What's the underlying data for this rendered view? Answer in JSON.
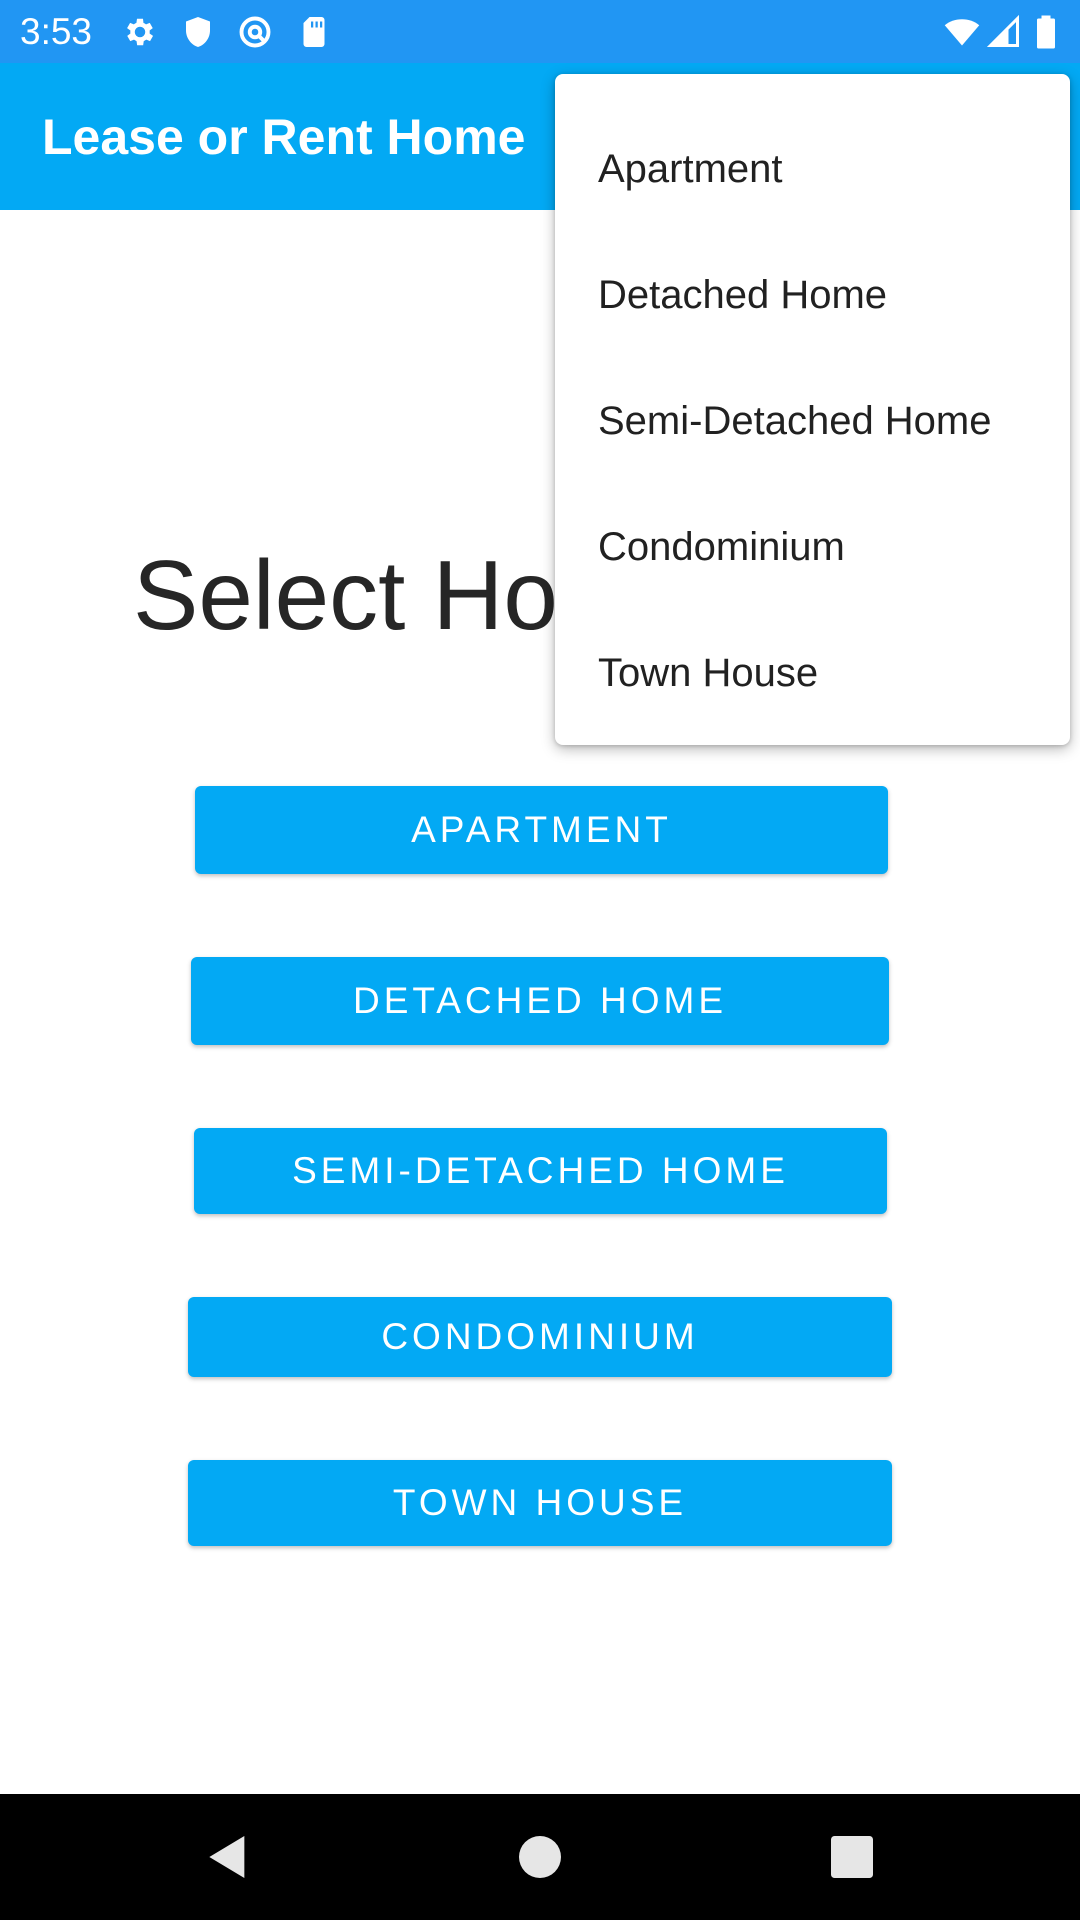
{
  "status_bar": {
    "time": "3:53",
    "icons_left": [
      "gear-icon",
      "shield-icon",
      "at-sign-icon",
      "sd-card-icon"
    ],
    "icons_right": [
      "wifi-icon",
      "signal-icon",
      "battery-icon"
    ]
  },
  "app_bar": {
    "title": "Lease or Rent Home"
  },
  "main": {
    "heading": "Select Ho",
    "buttons": [
      {
        "label": "APARTMENT"
      },
      {
        "label": "DETACHED HOME"
      },
      {
        "label": "SEMI-DETACHED HOME"
      },
      {
        "label": "CONDOMINIUM"
      },
      {
        "label": "TOWN HOUSE"
      }
    ]
  },
  "menu": {
    "items": [
      {
        "label": "Apartment"
      },
      {
        "label": "Detached Home"
      },
      {
        "label": "Semi-Detached Home"
      },
      {
        "label": "Condominium"
      },
      {
        "label": "Town House"
      }
    ]
  },
  "nav_bar": {
    "buttons": [
      "back-icon",
      "home-icon",
      "recents-icon"
    ]
  },
  "colors": {
    "status_bar": "#2196f3",
    "app_bar": "#03a9f4",
    "button": "#03a9f4",
    "nav_bar": "#000000"
  }
}
